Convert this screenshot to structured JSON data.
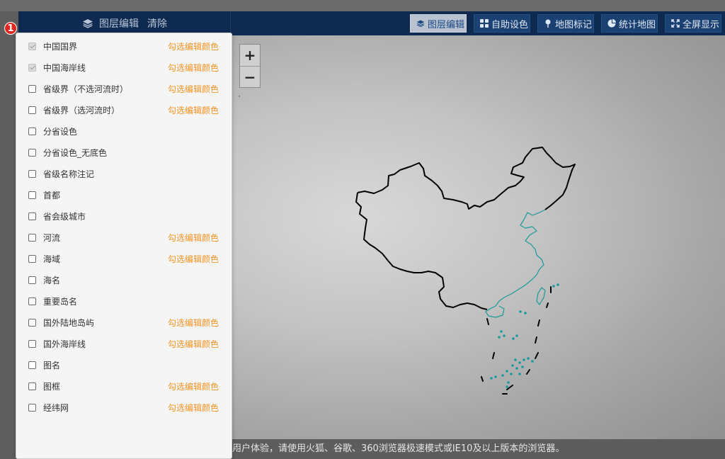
{
  "toolbar": {
    "layer_edit_label": "图层编辑",
    "clear_label": "清除",
    "buttons": [
      {
        "label": "图层编辑",
        "active": true
      },
      {
        "label": "自助设色",
        "active": false
      },
      {
        "label": "地图标记",
        "active": false
      },
      {
        "label": "统计地图",
        "active": false
      },
      {
        "label": "全屏显示",
        "active": false
      }
    ]
  },
  "badge": "1",
  "zoom": {
    "in": "+",
    "out": "−"
  },
  "layers": [
    {
      "label": "中国国界",
      "checked": true,
      "edit": "勾选编辑颜色"
    },
    {
      "label": "中国海岸线",
      "checked": true,
      "edit": "勾选编辑颜色"
    },
    {
      "label": "省级界（不选河流时）",
      "checked": false,
      "edit": "勾选编辑颜色"
    },
    {
      "label": "省级界（选河流时）",
      "checked": false,
      "edit": "勾选编辑颜色"
    },
    {
      "label": "分省设色",
      "checked": false,
      "edit": ""
    },
    {
      "label": "分省设色_无底色",
      "checked": false,
      "edit": ""
    },
    {
      "label": "省级名称注记",
      "checked": false,
      "edit": ""
    },
    {
      "label": "首都",
      "checked": false,
      "edit": ""
    },
    {
      "label": "省会级城市",
      "checked": false,
      "edit": ""
    },
    {
      "label": "河流",
      "checked": false,
      "edit": "勾选编辑颜色"
    },
    {
      "label": "海域",
      "checked": false,
      "edit": "勾选编辑颜色"
    },
    {
      "label": "海名",
      "checked": false,
      "edit": ""
    },
    {
      "label": "重要岛名",
      "checked": false,
      "edit": ""
    },
    {
      "label": "国外陆地岛屿",
      "checked": false,
      "edit": "勾选编辑颜色"
    },
    {
      "label": "国外海岸线",
      "checked": false,
      "edit": "勾选编辑颜色"
    },
    {
      "label": "图名",
      "checked": false,
      "edit": ""
    },
    {
      "label": "图框",
      "checked": false,
      "edit": "勾选编辑颜色"
    },
    {
      "label": "经纬网",
      "checked": false,
      "edit": "勾选编辑颜色"
    }
  ],
  "notice": "用户体验，请使用火狐、谷歌、360浏览器极速模式或IE10及以上版本的浏览器。",
  "colors": {
    "toolbar_bg": "#0f2a50",
    "edit_link": "#f39424",
    "border_line": "#000000",
    "coast_line": "#1a9a9a",
    "badge": "#e0261f"
  }
}
